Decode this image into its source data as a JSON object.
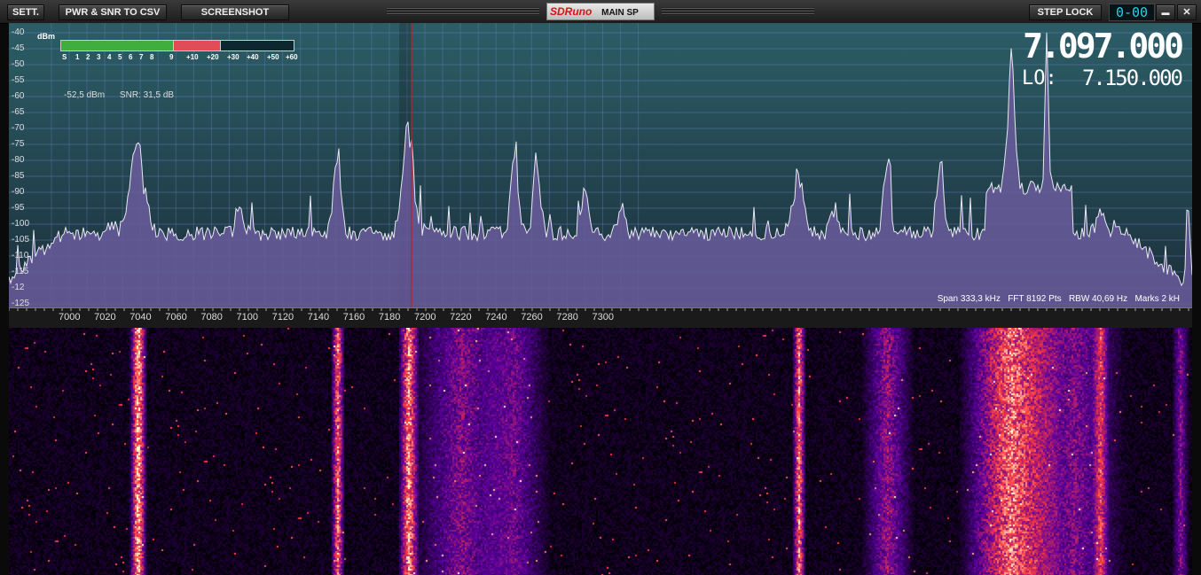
{
  "toolbar": {
    "settings": "SETT.",
    "pwr_snr_csv": "PWR & SNR TO CSV",
    "screenshot": "SCREENSHOT",
    "brand": "SDRuno",
    "panel": "MAIN SP",
    "step_lock": "STEP LOCK",
    "lcd_value": "0-00",
    "minimize": "▬",
    "close": "✕"
  },
  "spectrum": {
    "unit": "dBm",
    "y_ticks": [
      "-40",
      "-45",
      "-50",
      "-55",
      "-60",
      "-65",
      "-70",
      "-75",
      "-80",
      "-85",
      "-90",
      "-95",
      "-100",
      "-105",
      "-110",
      "-115",
      "-12",
      "-125"
    ],
    "x_ticks": [
      "7000",
      "7020",
      "7040",
      "7060",
      "7080",
      "7100",
      "7120",
      "7140",
      "7160",
      "7180",
      "7200",
      "7220",
      "7240",
      "7260",
      "7280",
      "7300"
    ],
    "frequency": "7.097.000",
    "lo_label": "LO:",
    "lo_frequency": "7.150.000",
    "power": "-52,5 dBm",
    "snr": "SNR: 31,5 dB",
    "span": "Span 333,3 kHz",
    "fft": "FFT 8192 Pts",
    "rbw": "RBW 40,69 Hz",
    "marks": "Marks 2 kH",
    "meter_labels": [
      "S",
      "1",
      "2",
      "3",
      "4",
      "5",
      "6",
      "7",
      "8",
      "9",
      "+10",
      "+20",
      "+30",
      "+40",
      "+50",
      "+60"
    ]
  },
  "colors": {
    "meter_green": "#3fae3f",
    "meter_red": "#e04d56",
    "trace": "#e8e8f0",
    "fill": "#6a5c9c",
    "tuning_line": "#c0202a"
  }
}
